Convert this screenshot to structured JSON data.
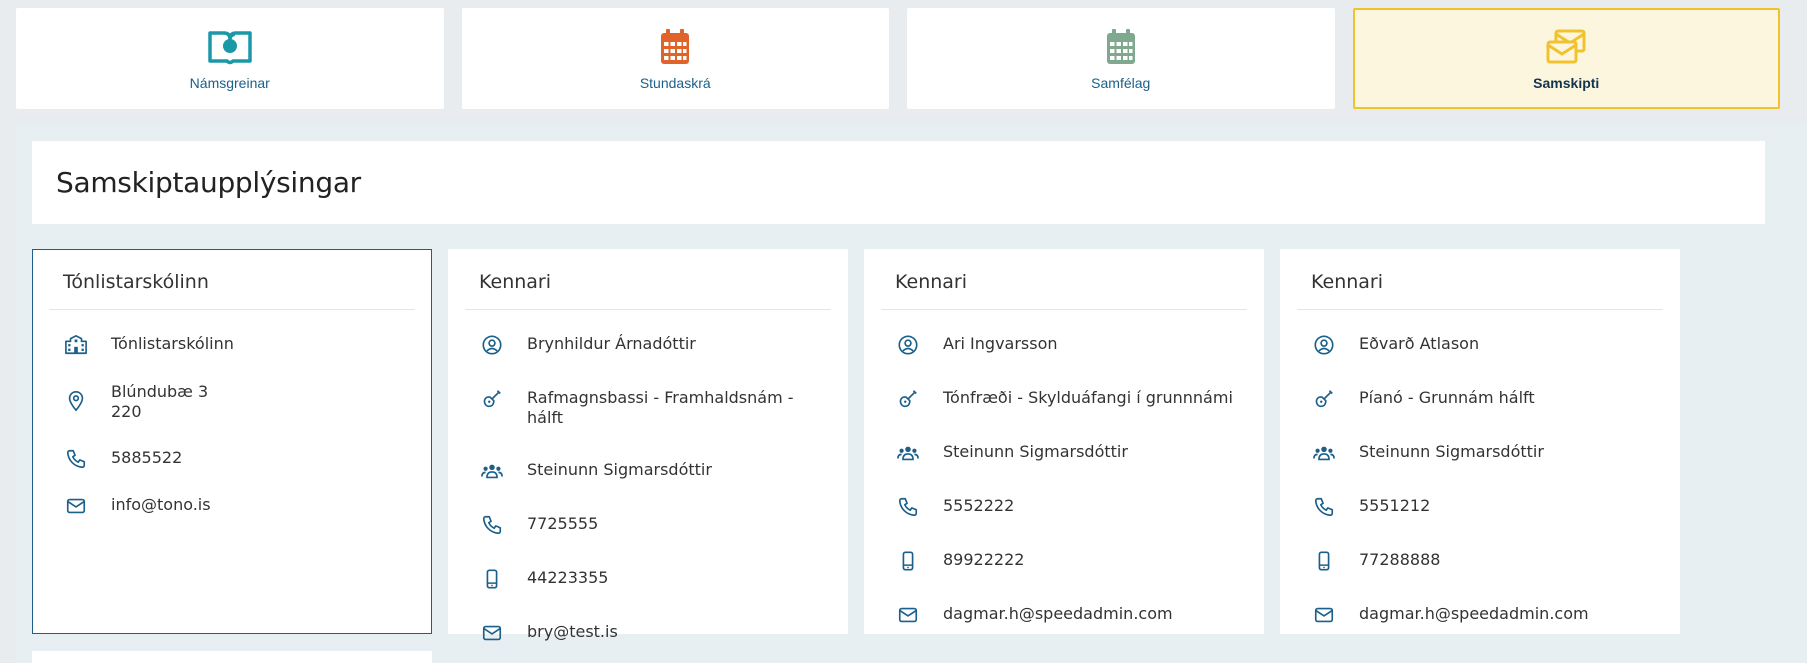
{
  "nav": {
    "tiles": [
      {
        "label": "Námsgreinar",
        "icon": "book-apple-icon",
        "color": "#1a98a8"
      },
      {
        "label": "Stundaskrá",
        "icon": "calendar-icon",
        "color": "#e0632a"
      },
      {
        "label": "Samfélag",
        "icon": "calendar-grid-icon",
        "color": "#7fa88f"
      },
      {
        "label": "Samskipti",
        "icon": "envelopes-icon",
        "color": "#f2c22e",
        "active": true
      }
    ]
  },
  "page": {
    "title": "Samskiptaupplýsingar"
  },
  "school": {
    "heading": "Tónlistarskólinn",
    "name": "Tónlistarskólinn",
    "address_line1": "Blúndubæ 3",
    "address_line2": "220",
    "phone": "5885522",
    "email": "info@tono.is"
  },
  "teachers": [
    {
      "heading": "Kennari",
      "name": "Brynhildur Árnadóttir",
      "course": "Rafmagnsbassi - Framhaldsnám - hálft",
      "student": "Steinunn Sigmarsdóttir",
      "phone": "7725555",
      "mobile": "44223355",
      "email": "bry@test.is"
    },
    {
      "heading": "Kennari",
      "name": "Ari Ingvarsson",
      "course": "Tónfræði - Skylduáfangi í grunnnámi",
      "student": "Steinunn Sigmarsdóttir",
      "phone": "5552222",
      "mobile": "89922222",
      "email": "dagmar.h@speedadmin.com"
    },
    {
      "heading": "Kennari",
      "name": "Eðvarð Atlason",
      "course": "Píanó - Grunnám hálft",
      "student": "Steinunn Sigmarsdóttir",
      "phone": "5551212",
      "mobile": "77288888",
      "email": "dagmar.h@speedadmin.com"
    }
  ],
  "colors": {
    "accent": "#1b5f8a",
    "active_border": "#f2c22e",
    "active_bg": "#fdf6de"
  }
}
